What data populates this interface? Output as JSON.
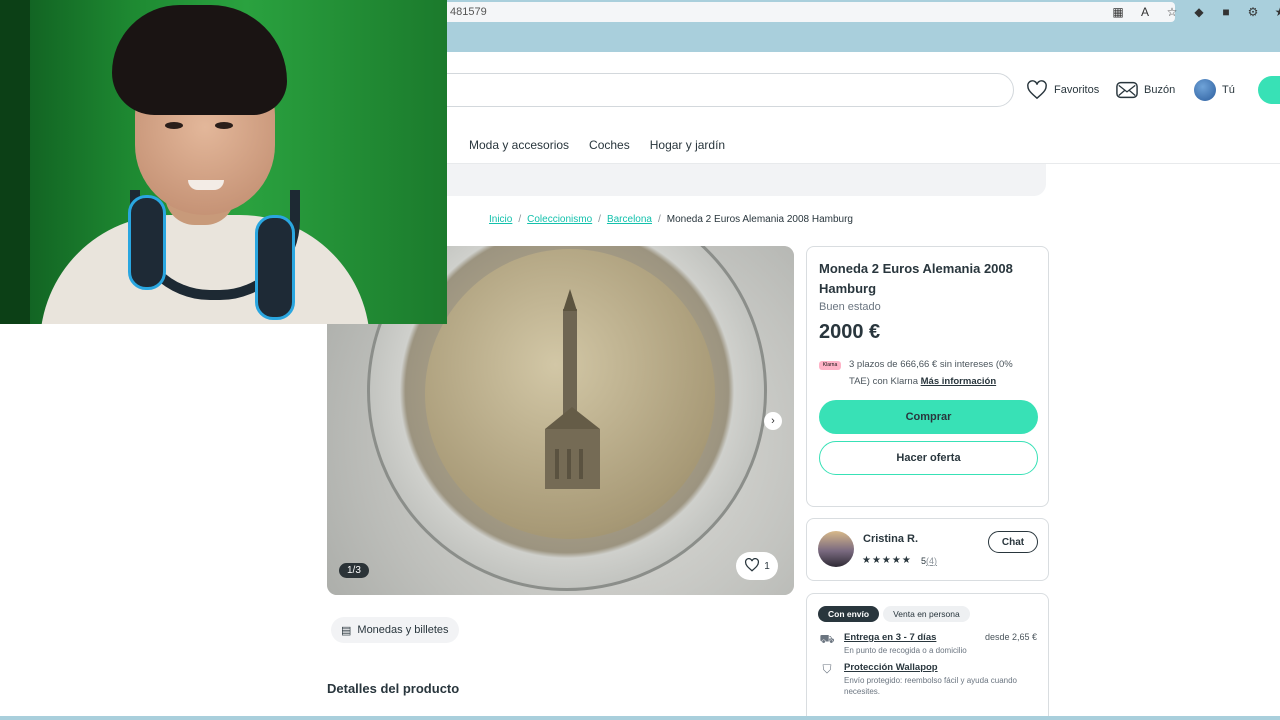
{
  "browser": {
    "url_fragment": "481579"
  },
  "header": {
    "favorites_label": "Favoritos",
    "inbox_label": "Buzón",
    "profile_label": "Tú"
  },
  "categories": [
    "Moda y accesorios",
    "Coches",
    "Hogar y jardín"
  ],
  "breadcrumb": {
    "home": "Inicio",
    "category": "Coleccionismo",
    "city": "Barcelona",
    "current": "Moneda 2 Euros Alemania 2008 Hamburg",
    "separator": "/"
  },
  "gallery": {
    "counter": "1/3",
    "favorites_count": "1",
    "next_icon": "chevron-right-icon"
  },
  "category_chip": "Monedas y billetes",
  "details_title": "Detalles del producto",
  "product": {
    "title": "Moneda 2 Euros Alemania 2008 Hamburg",
    "condition": "Buen estado",
    "price": "2000 €",
    "klarna_badge": "Klarna",
    "klarna_text": "3 plazos de 666,66 € sin intereses (0% TAE) con Klarna",
    "klarna_link": "Más información",
    "buy_label": "Comprar",
    "offer_label": "Hacer oferta"
  },
  "seller": {
    "name": "Cristina R.",
    "stars": "★★★★★",
    "rating": "5",
    "reviews": "(4)",
    "chat_label": "Chat"
  },
  "shipping": {
    "tab_shipping": "Con envío",
    "tab_inperson": "Venta en persona",
    "delivery_title": "Entrega en 3 - 7 días",
    "delivery_sub": "En punto de recogida o a domicilio",
    "delivery_price": "desde 2,65 €",
    "protection_title": "Protección Wallapop",
    "protection_sub": "Envío protegido: reembolso fácil y ayuda cuando necesites."
  },
  "colors": {
    "brand": "#38e1b6",
    "link": "#13c1ac",
    "text": "#29363d"
  }
}
